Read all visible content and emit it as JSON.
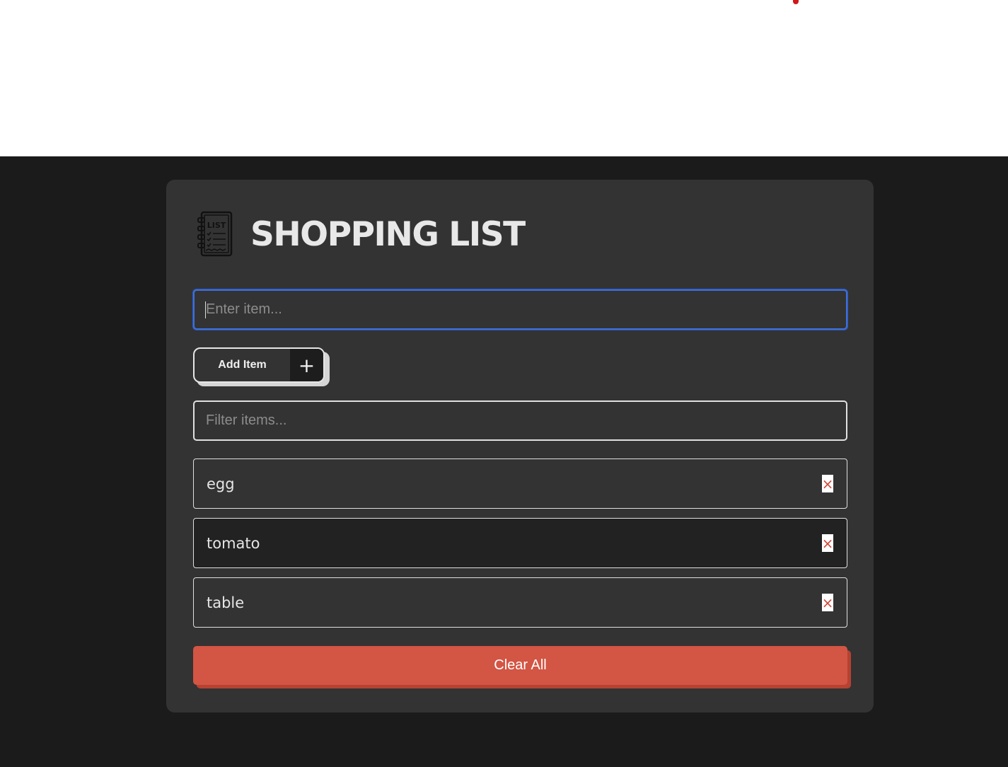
{
  "colors": {
    "page_background": "#1b1b1b",
    "card_background": "#333333",
    "focus_border": "#3f6fd8",
    "clear_button": "#d35544",
    "remove_icon": "#d34a3a"
  },
  "header": {
    "logo_text": "LIST",
    "title": "SHOPPING LIST"
  },
  "item_input": {
    "placeholder": "Enter item...",
    "value": ""
  },
  "add_button": {
    "label": "Add Item",
    "icon": "plus-icon",
    "icon_glyph": "+"
  },
  "filter_input": {
    "placeholder": "Filter items...",
    "value": ""
  },
  "items": [
    {
      "label": "egg",
      "remove_icon": "close-icon",
      "remove_glyph": "×"
    },
    {
      "label": "tomato",
      "remove_icon": "close-icon",
      "remove_glyph": "×"
    },
    {
      "label": "table",
      "remove_icon": "close-icon",
      "remove_glyph": "×"
    }
  ],
  "clear_button": {
    "label": "Clear All"
  }
}
